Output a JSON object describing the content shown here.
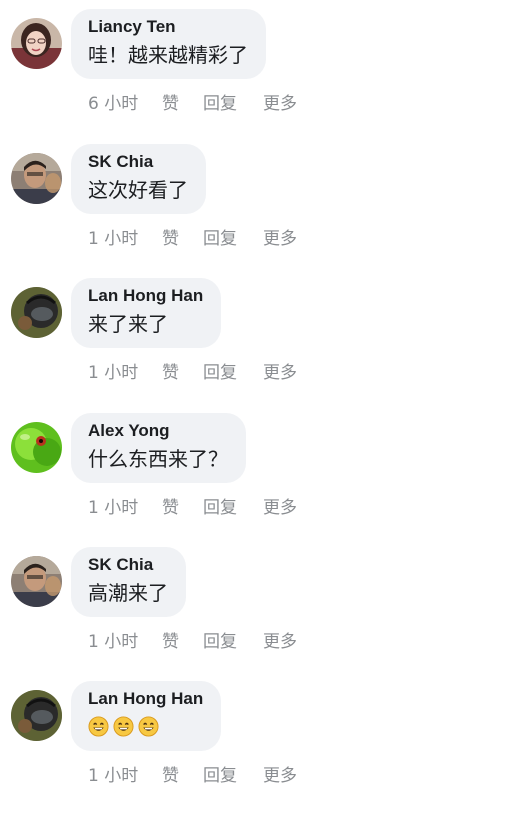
{
  "actions": {
    "like": "赞",
    "reply": "回复",
    "more": "更多"
  },
  "comments": [
    {
      "author": "Liancy Ten",
      "text": "哇！越来越精彩了",
      "time": "6 小时",
      "avatar_icon": "woman-portrait-avatar"
    },
    {
      "author": "SK Chia",
      "text": "这次好看了",
      "time": "1 小时",
      "avatar_icon": "man-portrait-avatar"
    },
    {
      "author": "Lan Hong Han",
      "text": "来了来了",
      "time": "1 小时",
      "avatar_icon": "helmet-rider-avatar"
    },
    {
      "author": "Alex Yong",
      "text": "什么东西来了？",
      "time": "1 小时",
      "avatar_icon": "green-frog-avatar"
    },
    {
      "author": "SK Chia",
      "text": "高潮来了",
      "time": "1 小时",
      "avatar_icon": "man-portrait-avatar"
    },
    {
      "author": "Lan Hong Han",
      "text": "",
      "time": "1 小时",
      "avatar_icon": "helmet-rider-avatar",
      "emoji": [
        "grinning-face",
        "grinning-face",
        "grinning-face"
      ]
    }
  ],
  "colors": {
    "bubble_bg": "#f0f2f5",
    "name_text": "#1c1e21",
    "meta_text": "#8a8d91"
  }
}
